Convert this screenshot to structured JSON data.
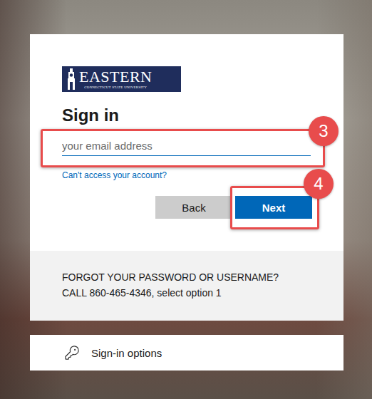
{
  "logo": {
    "name": "EASTERN",
    "subtitle": "CONNECTICUT STATE UNIVERSITY"
  },
  "title": "Sign in",
  "email_field": {
    "placeholder": "your email address",
    "focused": true,
    "annotation": "3"
  },
  "link": "Can't access your account?",
  "buttons": [
    {
      "label": "Back",
      "kind": "secondary",
      "annotation": ""
    },
    {
      "label": "Next",
      "kind": "primary",
      "annotation": "4"
    }
  ],
  "footer": "FORGOT YOUR PASSWORD OR USERNAME? CALL 860-465-4346, select option 1",
  "sign_in_options": "Sign-in options"
}
